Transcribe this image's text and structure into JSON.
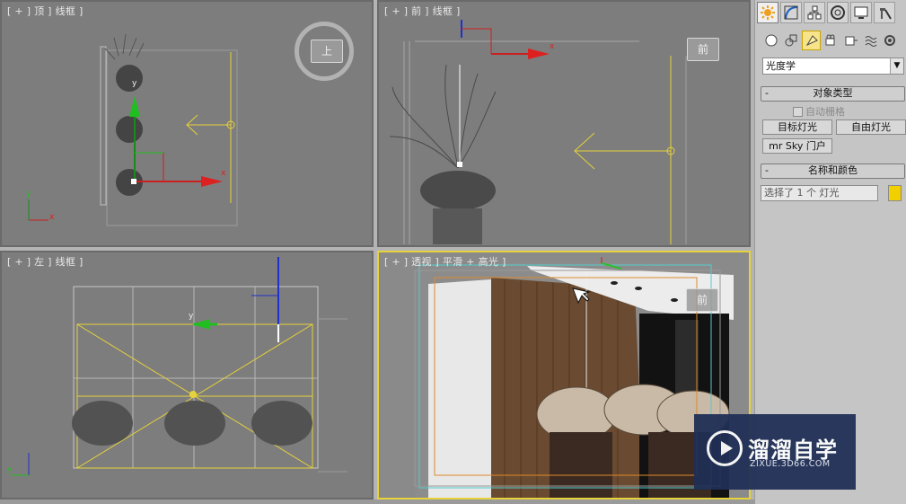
{
  "viewports": {
    "top": {
      "label": "[ + ] 顶 ] 线框 ]",
      "parts": [
        "[",
        "+",
        "]",
        "顶",
        "]",
        "线框",
        "]"
      ]
    },
    "front": {
      "label": "[ + ] 前 ] 线框 ]",
      "parts": [
        "[",
        "+",
        "]",
        "前",
        "]",
        "线框",
        "]"
      ],
      "cube_label": "前"
    },
    "left": {
      "label": "[ + ] 左 ] 线框 ]",
      "parts": [
        "[",
        "+",
        "]",
        "左",
        "]",
        "线框",
        "]"
      ]
    },
    "perspective": {
      "label": "[ + ] 透视 ] 平滑 + 高光 ]",
      "parts": [
        "[",
        "+",
        "]",
        "透视",
        "]",
        "平滑 + 高光",
        "]"
      ],
      "cube_label": "前"
    },
    "top_cube_label": "上"
  },
  "axis_labels": {
    "x": "x",
    "y": "y"
  },
  "command_panel": {
    "tabs": [
      "create-icon",
      "modify-icon",
      "hierarchy-icon",
      "motion-icon",
      "display-icon",
      "utilities-icon"
    ],
    "subtabs": [
      "geometry-icon",
      "shapes-icon",
      "lights-icon",
      "cameras-icon",
      "helpers-icon",
      "spacewarps-icon",
      "systems-icon"
    ],
    "category_dropdown": "光度学",
    "object_type": {
      "title": "对象类型",
      "autogrid_label": "自动栅格",
      "buttons": [
        "目标灯光",
        "自由灯光",
        "mr Sky 门户"
      ]
    },
    "name_and_color": {
      "title": "名称和颜色",
      "name_value": "选择了 1 个 灯光",
      "color": "#f2d000"
    }
  },
  "watermark": {
    "title": "溜溜自学",
    "subtitle": "ZIXUE.3D66.COM"
  }
}
